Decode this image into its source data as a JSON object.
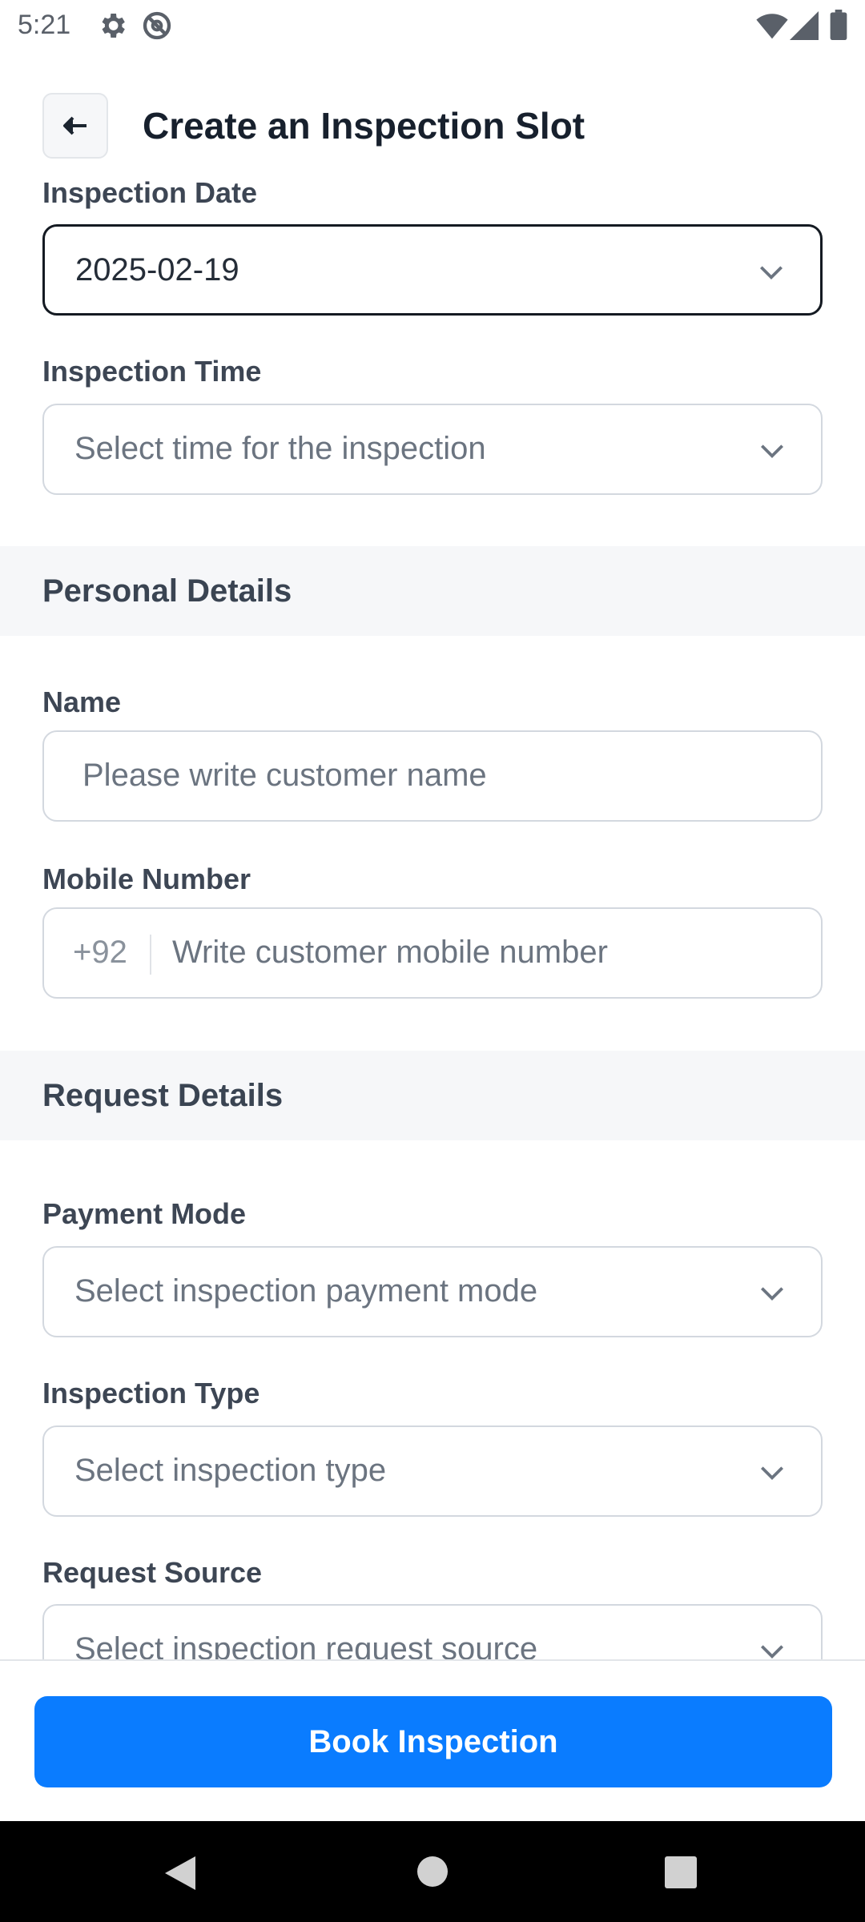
{
  "status_bar": {
    "time": "5:21",
    "left_icons": [
      "gear-icon",
      "no-sync-icon"
    ],
    "right_icons": [
      "wifi-icon",
      "signal-icon",
      "battery-icon"
    ]
  },
  "header": {
    "back_icon": "arrow-left-icon",
    "title": "Create an Inspection Slot"
  },
  "inspection_date": {
    "label": "Inspection Date",
    "value": "2025-02-19"
  },
  "inspection_time": {
    "label": "Inspection Time",
    "placeholder": "Select time for the inspection"
  },
  "personal_section": {
    "title": "Personal Details"
  },
  "name": {
    "label": "Name",
    "placeholder": "Please write customer name"
  },
  "mobile": {
    "label": "Mobile Number",
    "prefix": "+92",
    "placeholder": "Write customer mobile number"
  },
  "request_section": {
    "title": "Request Details"
  },
  "payment_mode": {
    "label": "Payment Mode",
    "placeholder": "Select inspection payment mode"
  },
  "inspection_type": {
    "label": "Inspection Type",
    "placeholder": "Select inspection type"
  },
  "request_source": {
    "label": "Request Source",
    "placeholder": "Select inspection request source"
  },
  "cta": {
    "label": "Book Inspection",
    "color": "#0a7cff"
  },
  "nav_bar": {
    "icons": [
      "back-triangle-icon",
      "home-circle-icon",
      "recents-square-icon"
    ]
  }
}
